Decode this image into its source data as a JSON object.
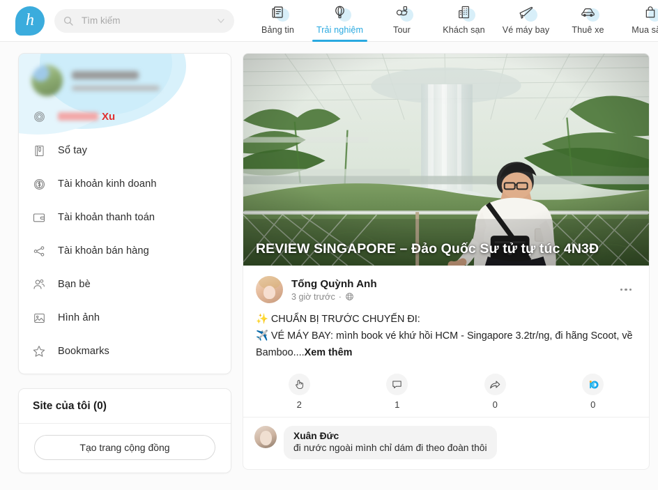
{
  "header": {
    "logo_letter": "h",
    "search": {
      "placeholder": "Tìm kiếm",
      "value": ""
    },
    "tabs": [
      {
        "label": "Bảng tin",
        "icon": "news-icon",
        "active": false
      },
      {
        "label": "Trải nghiệm",
        "icon": "balloon-icon",
        "active": true
      },
      {
        "label": "Tour",
        "icon": "tour-icon",
        "active": false
      },
      {
        "label": "Khách sạn",
        "icon": "hotel-icon",
        "active": false
      },
      {
        "label": "Vé máy bay",
        "icon": "airplane-icon",
        "active": false
      },
      {
        "label": "Thuê xe",
        "icon": "car-icon",
        "active": false
      },
      {
        "label": "Mua sắm",
        "icon": "shopping-icon",
        "active": false
      }
    ]
  },
  "sidebar": {
    "profile": {
      "name_redacted": true,
      "subtitle_redacted": true
    },
    "coin": {
      "amount_redacted": true,
      "label": "Xu"
    },
    "menu": [
      {
        "label": "Sổ tay",
        "icon": "notebook-icon"
      },
      {
        "label": "Tài khoản kinh doanh",
        "icon": "coin-dollar-icon"
      },
      {
        "label": "Tài khoản thanh toán",
        "icon": "wallet-icon"
      },
      {
        "label": "Tài khoản bán hàng",
        "icon": "share-network-icon"
      },
      {
        "label": "Bạn bè",
        "icon": "friends-icon"
      },
      {
        "label": "Hình ảnh",
        "icon": "image-icon"
      },
      {
        "label": "Bookmarks",
        "icon": "star-icon"
      }
    ],
    "site_section": {
      "title": "Site của tôi (0)",
      "create_button": "Tạo trang cộng đồng"
    }
  },
  "post": {
    "hero_title": "REVIEW SINGAPORE – Đảo Quốc Sư tử tự túc 4N3Đ",
    "author": {
      "name": "Tống Quỳnh Anh",
      "time": "3 giờ trước",
      "separator": "·",
      "privacy_icon": "globe-icon"
    },
    "more_menu_icon": "ellipsis-icon",
    "body_line1": "✨ CHUẨN BỊ TRƯỚC CHUYẾN ĐI:",
    "body_line2": "✈️ VÉ MÁY BAY: mình book vé khứ hồi HCM - Singapore 3.2tr/ng, đi hãng Scoot, về Bamboo....",
    "see_more": "Xem thêm",
    "actions": [
      {
        "name": "like",
        "icon": "hand-like-icon",
        "count": "2"
      },
      {
        "name": "comment",
        "icon": "comment-icon",
        "count": "1"
      },
      {
        "name": "share",
        "icon": "share-arrow-icon",
        "count": "0"
      },
      {
        "name": "reward",
        "icon": "coin-reward-icon",
        "count": "0"
      }
    ],
    "comments": [
      {
        "name": "Xuân Đức",
        "text": "đi nước ngoài mình chỉ dám đi theo đoàn thôi"
      }
    ]
  },
  "colors": {
    "accent": "#29a9e0",
    "logo_blue": "#3bacdd",
    "coin_red": "#e03030",
    "icon_halo": "#d8eff9",
    "page_bg": "#fbfbfb"
  }
}
